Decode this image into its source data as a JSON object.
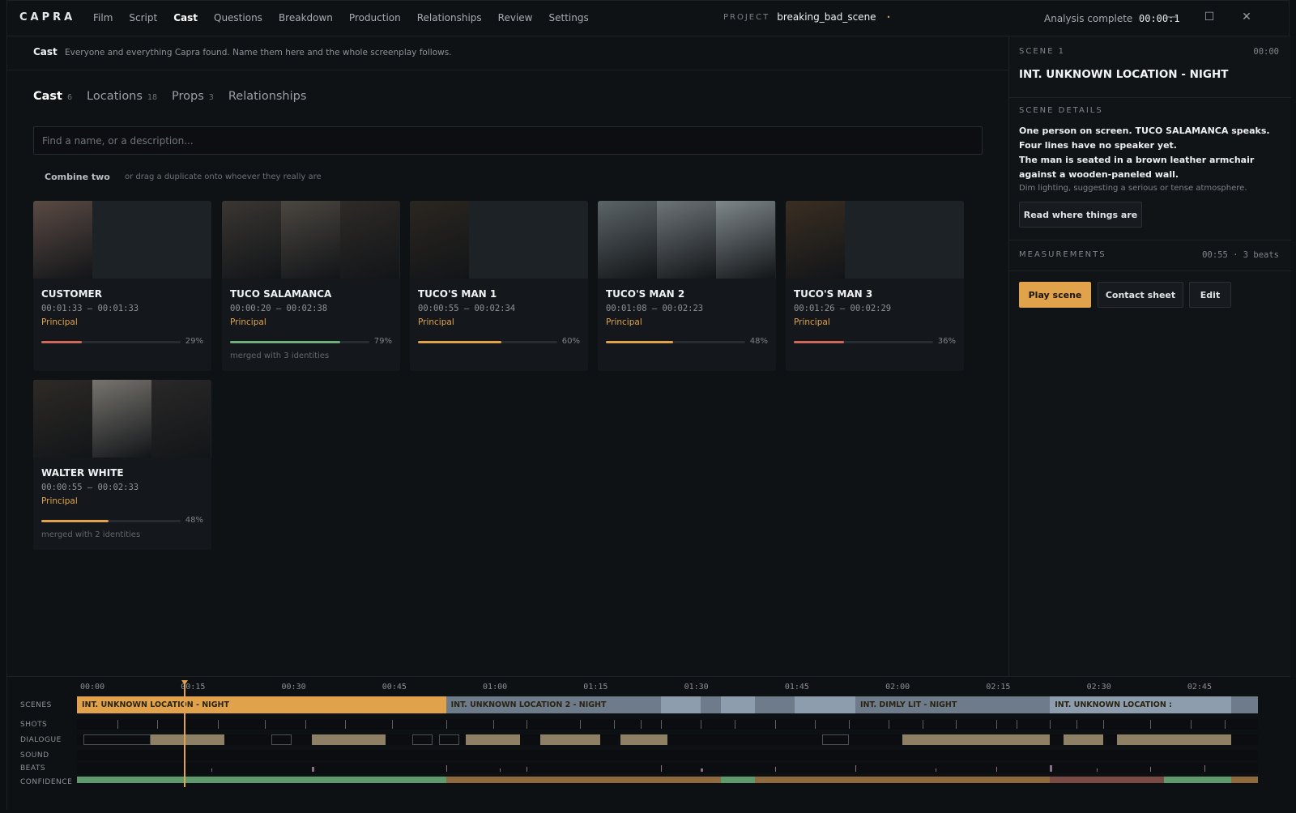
{
  "app": {
    "logo": "CAPRA"
  },
  "nav": {
    "items": [
      "Film",
      "Script",
      "Cast",
      "Questions",
      "Breakdown",
      "Production",
      "Relationships",
      "Review",
      "Settings"
    ],
    "active": "Cast"
  },
  "project": {
    "label": "PROJECT",
    "name": "breaking_bad_scene",
    "indicator": "•"
  },
  "status": {
    "text": "Analysis complete",
    "clock": "00:00:1"
  },
  "window_controls": {
    "minimize": "—",
    "maximize": "☐",
    "close": "✕"
  },
  "page": {
    "title": "Cast",
    "subtitle": "Everyone and everything Capra found. Name them here and the whole screenplay follows."
  },
  "tabs": [
    {
      "label": "Cast",
      "count": "6"
    },
    {
      "label": "Locations",
      "count": "18"
    },
    {
      "label": "Props",
      "count": "3"
    },
    {
      "label": "Relationships",
      "count": ""
    }
  ],
  "search": {
    "placeholder": "Find a name, or a description..."
  },
  "combine": {
    "label": "Combine two",
    "hint": "or drag a duplicate onto whoever they really are"
  },
  "cast": [
    {
      "name": "CUSTOMER",
      "time": "00:01:33 – 00:01:33",
      "role": "Principal",
      "pct_label": "29%",
      "pct": 29,
      "color": "#d0695a",
      "merged": ""
    },
    {
      "name": "TUCO SALAMANCA",
      "time": "00:00:20 – 00:02:38",
      "role": "Principal",
      "pct_label": "79%",
      "pct": 79,
      "color": "#6fae7a",
      "merged": "merged with 3 identities"
    },
    {
      "name": "TUCO'S MAN 1",
      "time": "00:00:55 – 00:02:34",
      "role": "Principal",
      "pct_label": "60%",
      "pct": 60,
      "color": "#e0a24a",
      "merged": ""
    },
    {
      "name": "TUCO'S MAN 2",
      "time": "00:01:08 – 00:02:23",
      "role": "Principal",
      "pct_label": "48%",
      "pct": 48,
      "color": "#e0a24a",
      "merged": ""
    },
    {
      "name": "TUCO'S MAN 3",
      "time": "00:01:26 – 00:02:29",
      "role": "Principal",
      "pct_label": "36%",
      "pct": 36,
      "color": "#d0695a",
      "merged": ""
    },
    {
      "name": "WALTER WHITE",
      "time": "00:00:55 – 00:02:33",
      "role": "Principal",
      "pct_label": "48%",
      "pct": 48,
      "color": "#e0a24a",
      "merged": "merged with 2 identities"
    }
  ],
  "panel": {
    "scene_label": "SCENE 1",
    "scene_time": "00:00",
    "scene_title": "INT. UNKNOWN LOCATION - NIGHT",
    "details_label": "SCENE DETAILS",
    "details_1": "One person on screen. TUCO SALAMANCA speaks. Four lines have no speaker yet.",
    "details_2": "The man is seated in a brown leather armchair against a wooden-paneled wall.",
    "details_3": "Dim lighting, suggesting a serious or tense atmosphere.",
    "read_button": "Read where things are",
    "measurements_label": "MEASUREMENTS",
    "measurements_value": "00:55 · 3 beats",
    "play_button": "Play scene",
    "contact_button": "Contact sheet",
    "edit_button": "Edit"
  },
  "timeline": {
    "ticks": [
      "00:00",
      "00:15",
      "00:30",
      "00:45",
      "01:00",
      "01:15",
      "01:30",
      "01:45",
      "02:00",
      "02:15",
      "02:30",
      "02:45"
    ],
    "rows": [
      "SCENES",
      "SHOTS",
      "DIALOGUE",
      "SOUND",
      "BEATS",
      "CONFIDENCE"
    ],
    "scenes": [
      {
        "label": "INT. UNKNOWN LOCATION - NIGHT",
        "start": 0,
        "end": 55,
        "color": "#e0a24a"
      },
      {
        "label": "INT. UNKNOWN LOCATION 2 - NIGHT",
        "start": 55,
        "end": 87,
        "color": "#6e7b8a"
      },
      {
        "label": "",
        "start": 87,
        "end": 93,
        "color": "#8e9dad"
      },
      {
        "label": "",
        "start": 93,
        "end": 96,
        "color": "#6e7b8a"
      },
      {
        "label": "",
        "start": 96,
        "end": 101,
        "color": "#8e9dad"
      },
      {
        "label": "",
        "start": 101,
        "end": 107,
        "color": "#6e7b8a"
      },
      {
        "label": "",
        "start": 107,
        "end": 116,
        "color": "#8e9dad"
      },
      {
        "label": "INT. DIMLY LIT - NIGHT",
        "start": 116,
        "end": 145,
        "color": "#6e7b8a"
      },
      {
        "label": "INT. UNKNOWN LOCATION :",
        "start": 145,
        "end": 172,
        "color": "#8e9dad"
      },
      {
        "label": "",
        "start": 172,
        "end": 176,
        "color": "#6e7b8a"
      }
    ],
    "playhead": 15,
    "duration": 176
  },
  "colors": {
    "accent": "#e0a24a",
    "green": "#6fae7a",
    "red": "#d0695a"
  }
}
